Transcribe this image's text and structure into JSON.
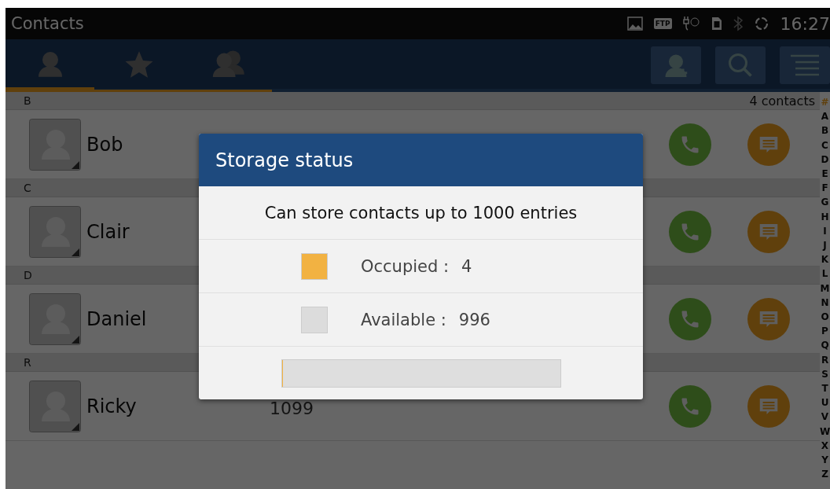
{
  "status_bar": {
    "title": "Contacts",
    "ftp_badge": "FTP",
    "time": "16:27"
  },
  "tabs": [
    {
      "kind": "person",
      "selected": true
    },
    {
      "kind": "star",
      "selected": false
    },
    {
      "kind": "group",
      "selected": false
    }
  ],
  "contact_count": "4 contacts",
  "sections": [
    {
      "letter": "B",
      "contacts": [
        {
          "name": "Bob"
        }
      ]
    },
    {
      "letter": "C",
      "contacts": [
        {
          "name": "Clair"
        }
      ]
    },
    {
      "letter": "D",
      "contacts": [
        {
          "name": "Daniel"
        }
      ]
    },
    {
      "letter": "R",
      "contacts": [
        {
          "name": "Ricky",
          "number": "1099"
        }
      ]
    }
  ],
  "index": [
    {
      "letter": "#",
      "selected": true
    },
    {
      "letter": "A",
      "selected": false
    },
    {
      "letter": "B",
      "selected": false
    },
    {
      "letter": "C",
      "selected": false
    },
    {
      "letter": "D",
      "selected": false
    },
    {
      "letter": "E",
      "selected": false
    },
    {
      "letter": "F",
      "selected": false
    },
    {
      "letter": "G",
      "selected": false
    },
    {
      "letter": "H",
      "selected": false
    },
    {
      "letter": "I",
      "selected": false
    },
    {
      "letter": "J",
      "selected": false
    },
    {
      "letter": "K",
      "selected": false
    },
    {
      "letter": "L",
      "selected": false
    },
    {
      "letter": "M",
      "selected": false
    },
    {
      "letter": "N",
      "selected": false
    },
    {
      "letter": "O",
      "selected": false
    },
    {
      "letter": "P",
      "selected": false
    },
    {
      "letter": "Q",
      "selected": false
    },
    {
      "letter": "R",
      "selected": false
    },
    {
      "letter": "S",
      "selected": false
    },
    {
      "letter": "T",
      "selected": false
    },
    {
      "letter": "U",
      "selected": false
    },
    {
      "letter": "V",
      "selected": false
    },
    {
      "letter": "W",
      "selected": false
    },
    {
      "letter": "X",
      "selected": false
    },
    {
      "letter": "Y",
      "selected": false
    },
    {
      "letter": "Z",
      "selected": false
    }
  ],
  "dialog": {
    "title": "Storage status",
    "message": "Can store contacts up to 1000 entries",
    "legend": [
      {
        "label": "Occupied :",
        "value": "4",
        "color": "#f2b242"
      },
      {
        "label": "Available :",
        "value": "996",
        "color": "#dcdcdc"
      }
    ],
    "usage": {
      "level": 0.004
    }
  }
}
